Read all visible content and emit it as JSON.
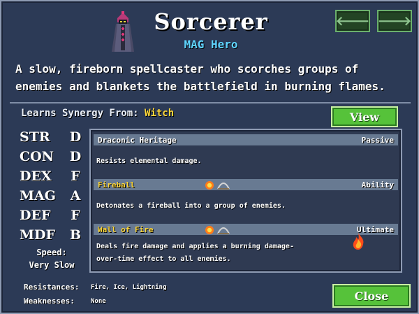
{
  "hero": {
    "name": "Sorcerer",
    "class_label": "MAG Hero",
    "description": "A slow, fireborn spellcaster who scorches groups of enemies and blankets the battlefield in burning flames."
  },
  "navigation": {
    "prev_icon": "arrow-left-icon",
    "next_icon": "arrow-right-icon",
    "prev_label": "🡐",
    "next_label": "🡒"
  },
  "synergy": {
    "label": "Learns Synergy From:",
    "value": "Witch",
    "view_label": "View"
  },
  "stats": [
    {
      "name": "STR",
      "grade": "D"
    },
    {
      "name": "CON",
      "grade": "D"
    },
    {
      "name": "DEX",
      "grade": "F"
    },
    {
      "name": "MAG",
      "grade": "A"
    },
    {
      "name": "DEF",
      "grade": "F"
    },
    {
      "name": "MDF",
      "grade": "B"
    }
  ],
  "speed": {
    "label": "Speed:",
    "value": "Very Slow"
  },
  "abilities": [
    {
      "name": "Draconic Heritage",
      "type": "Passive",
      "description": "Resists elemental damage."
    },
    {
      "name": "Fireball",
      "type": "Ability",
      "description": "Detonates a fireball into a group of enemies.",
      "icons": [
        "fire-icon",
        "bow-icon"
      ]
    },
    {
      "name": "Wall of Fire",
      "type": "Ultimate",
      "description_line1": "Deals fire damage and applies a burning damage-",
      "description_line2": "over-time effect to all enemies.",
      "icons": [
        "fire-icon",
        "bow-icon"
      ]
    }
  ],
  "resistances": {
    "label": "Resistances:",
    "value": "Fire, Ice, Lightning"
  },
  "weaknesses": {
    "label": "Weaknesses:",
    "value": "None"
  },
  "close_label": "Close",
  "colors": {
    "panel": "#2c3a56",
    "accent_green": "#56c23a",
    "gold": "#ffd83a",
    "cyan": "#5fd4ff",
    "portrait_pink": "#e0367a"
  }
}
